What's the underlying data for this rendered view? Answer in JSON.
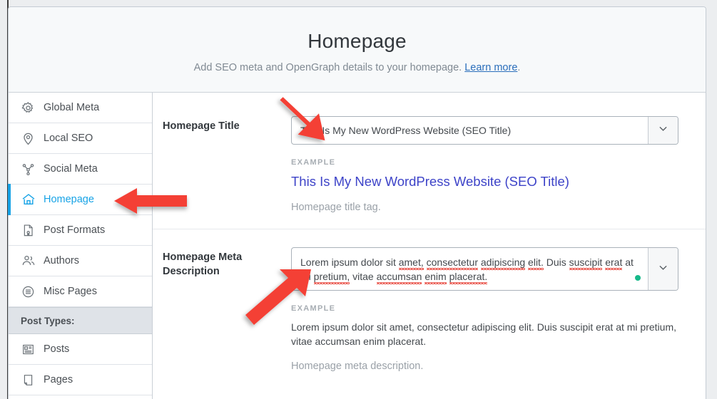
{
  "header": {
    "title": "Homepage",
    "subtitle_before": "Add SEO meta and OpenGraph details to your homepage. ",
    "link_label": "Learn more",
    "subtitle_after": "."
  },
  "sidebar": {
    "items": [
      {
        "label": "Global Meta",
        "icon": "gear-icon",
        "active": false
      },
      {
        "label": "Local SEO",
        "icon": "map-pin-icon",
        "active": false
      },
      {
        "label": "Social Meta",
        "icon": "share-icon",
        "active": false
      },
      {
        "label": "Homepage",
        "icon": "home-icon",
        "active": true
      },
      {
        "label": "Post Formats",
        "icon": "document-icon",
        "active": false
      },
      {
        "label": "Authors",
        "icon": "people-icon",
        "active": false
      },
      {
        "label": "Misc Pages",
        "icon": "list-circle-icon",
        "active": false
      }
    ],
    "section_label": "Post Types:",
    "post_type_items": [
      {
        "label": "Posts",
        "icon": "article-icon"
      },
      {
        "label": "Pages",
        "icon": "page-icon"
      }
    ]
  },
  "form": {
    "title_row": {
      "label": "Homepage Title",
      "value": "This Is My New WordPress Website (SEO Title)",
      "example_label": "EXAMPLE",
      "example_value": "This Is My New WordPress Website (SEO Title)",
      "help": "Homepage title tag."
    },
    "description_row": {
      "label": "Homepage Meta Description",
      "value_line1": "Lorem ipsum dolor sit amet, consectetur adipiscing elit. Duis suscipit erat at",
      "value_line2": "mi pretium, vitae accumsan enim placerat.",
      "example_label": "EXAMPLE",
      "example_value": "Lorem ipsum dolor sit amet, consectetur adipiscing elit. Duis suscipit erat at mi pretium, vitae accumsan enim placerat.",
      "help": "Homepage meta description."
    }
  },
  "colors": {
    "accent": "#17a3e6",
    "link": "#2a6ebb",
    "example_title": "#3d43c8",
    "status_dot": "#17b98a",
    "annotation_arrow": "#f43f35"
  },
  "annotations": [
    {
      "name": "arrow-to-title-input",
      "direction": "down-right"
    },
    {
      "name": "arrow-to-homepage-nav",
      "direction": "left"
    },
    {
      "name": "arrow-to-description-input",
      "direction": "up-right"
    }
  ]
}
